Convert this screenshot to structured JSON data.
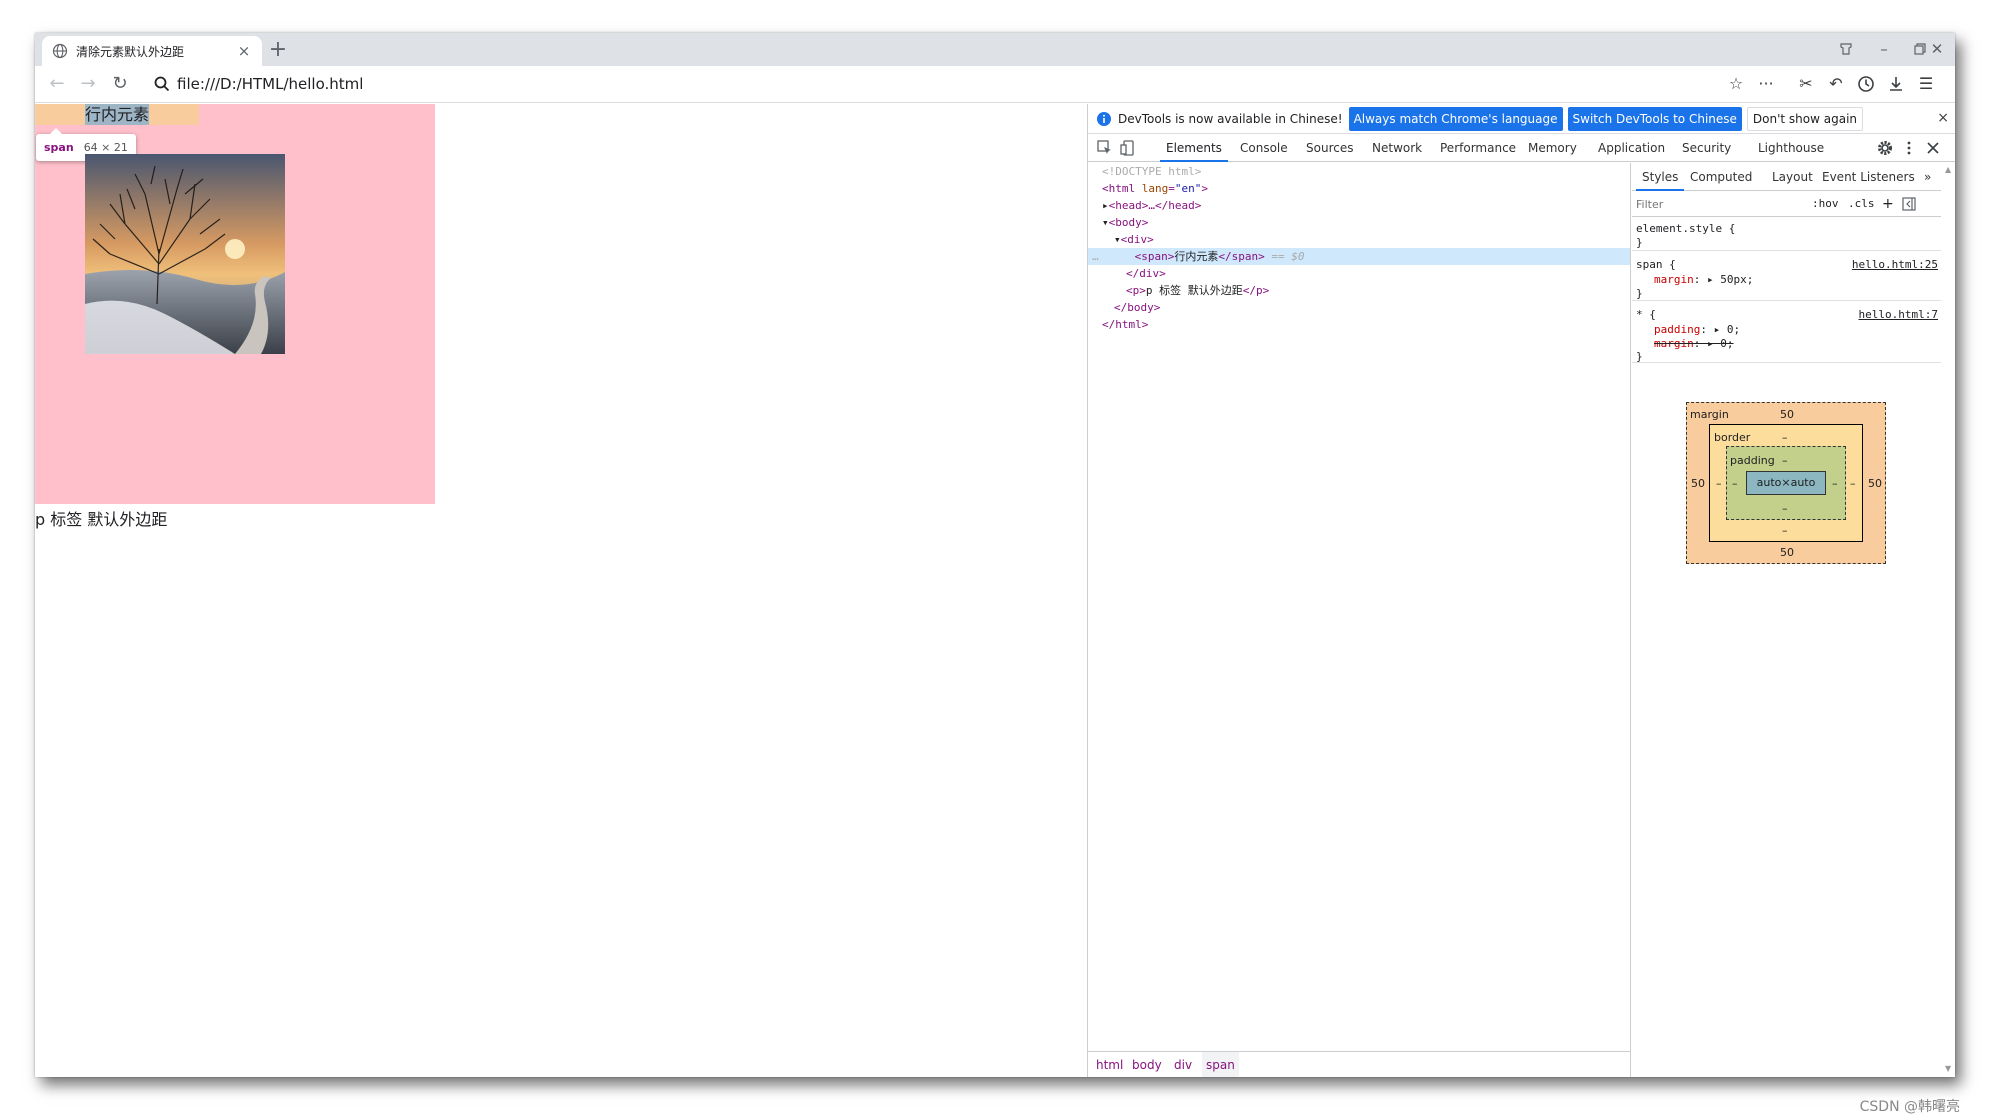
{
  "browser": {
    "tab_title": "清除元素默认外边距",
    "tab_close": "×",
    "new_tab": "+",
    "url": "file:///D:/HTML/hello.html"
  },
  "page": {
    "span_text": "行内元素",
    "paragraph_text": "p 标签 默认外边距",
    "tooltip_tag": "span",
    "tooltip_size": "64 × 21",
    "div_background": "#ffc0cb"
  },
  "devtools": {
    "infobar": {
      "message": "DevTools is now available in Chinese!",
      "btn_match": "Always match Chrome's language",
      "btn_switch": "Switch DevTools to Chinese",
      "btn_dismiss": "Don't show again",
      "close": "×"
    },
    "tabs": [
      "Elements",
      "Console",
      "Sources",
      "Network",
      "Performance",
      "Memory",
      "Application",
      "Security",
      "Lighthouse"
    ],
    "dom": {
      "doctype": "<!DOCTYPE html>",
      "html_open": "<html",
      "lang_attr": "lang",
      "lang_val": "\"en\"",
      "gt": ">",
      "head": "<head>…</head>",
      "body_open": "<body>",
      "div_open": "<div>",
      "span_open": "<span>",
      "span_text": "行内元素",
      "span_close": "</span>",
      "eq_sel": "== $0",
      "div_close": "</div>",
      "p_open": "<p>",
      "p_text": "p 标签 默认外边距",
      "p_close": "</p>",
      "body_close": "</body>",
      "html_close": "</html>",
      "dots": "…"
    },
    "breadcrumbs": [
      "html",
      "body",
      "div",
      "span"
    ],
    "styles": {
      "subtabs": [
        "Styles",
        "Computed",
        "Layout",
        "Event Listeners",
        "»"
      ],
      "filter_placeholder": "Filter",
      "hov": ":hov",
      "cls": ".cls",
      "plus": "+",
      "element_style": "element.style {",
      "close_brace": "}",
      "rule_span_selector": "span {",
      "rule_span_source": "hello.html:25",
      "rule_span_prop": "margin",
      "rule_span_value": "50px;",
      "rule_star_selector": "* {",
      "rule_star_source": "hello.html:7",
      "rule_star_prop1": "padding",
      "rule_star_value1": "0;",
      "rule_star_prop2": "margin",
      "rule_star_value2": "0;"
    },
    "box_model": {
      "margin_label": "margin",
      "margin_top": "50",
      "margin_bottom": "50",
      "margin_left": "50",
      "margin_right": "50",
      "border_label": "border",
      "border_top": "–",
      "border_bottom": "–",
      "border_left": "–",
      "border_right": "–",
      "padding_label": "padding",
      "padding_top": "–",
      "padding_bottom": "–",
      "padding_left": "–",
      "padding_right": "–",
      "content": "auto×auto",
      "colors": {
        "margin": "#f9cc9d",
        "border": "#fddd9b",
        "padding": "#c3d08b",
        "content": "#8cb6c0"
      }
    }
  },
  "watermark": "CSDN @韩曙亮"
}
